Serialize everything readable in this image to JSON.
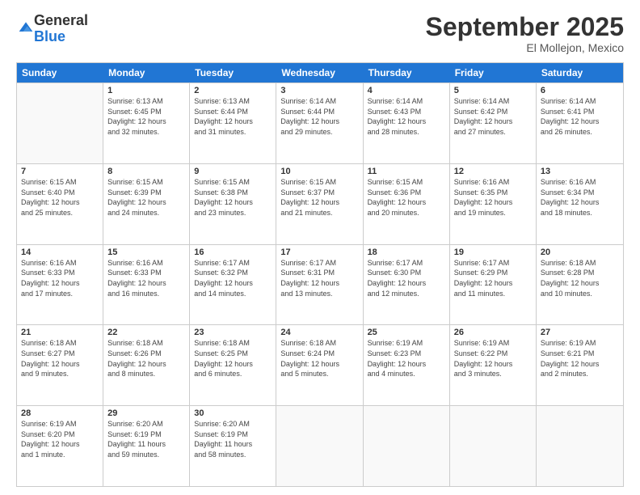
{
  "logo": {
    "general": "General",
    "blue": "Blue"
  },
  "title": "September 2025",
  "location": "El Mollejon, Mexico",
  "days_header": [
    "Sunday",
    "Monday",
    "Tuesday",
    "Wednesday",
    "Thursday",
    "Friday",
    "Saturday"
  ],
  "weeks": [
    [
      {
        "day": "",
        "info": ""
      },
      {
        "day": "1",
        "info": "Sunrise: 6:13 AM\nSunset: 6:45 PM\nDaylight: 12 hours\nand 32 minutes."
      },
      {
        "day": "2",
        "info": "Sunrise: 6:13 AM\nSunset: 6:44 PM\nDaylight: 12 hours\nand 31 minutes."
      },
      {
        "day": "3",
        "info": "Sunrise: 6:14 AM\nSunset: 6:44 PM\nDaylight: 12 hours\nand 29 minutes."
      },
      {
        "day": "4",
        "info": "Sunrise: 6:14 AM\nSunset: 6:43 PM\nDaylight: 12 hours\nand 28 minutes."
      },
      {
        "day": "5",
        "info": "Sunrise: 6:14 AM\nSunset: 6:42 PM\nDaylight: 12 hours\nand 27 minutes."
      },
      {
        "day": "6",
        "info": "Sunrise: 6:14 AM\nSunset: 6:41 PM\nDaylight: 12 hours\nand 26 minutes."
      }
    ],
    [
      {
        "day": "7",
        "info": "Sunrise: 6:15 AM\nSunset: 6:40 PM\nDaylight: 12 hours\nand 25 minutes."
      },
      {
        "day": "8",
        "info": "Sunrise: 6:15 AM\nSunset: 6:39 PM\nDaylight: 12 hours\nand 24 minutes."
      },
      {
        "day": "9",
        "info": "Sunrise: 6:15 AM\nSunset: 6:38 PM\nDaylight: 12 hours\nand 23 minutes."
      },
      {
        "day": "10",
        "info": "Sunrise: 6:15 AM\nSunset: 6:37 PM\nDaylight: 12 hours\nand 21 minutes."
      },
      {
        "day": "11",
        "info": "Sunrise: 6:15 AM\nSunset: 6:36 PM\nDaylight: 12 hours\nand 20 minutes."
      },
      {
        "day": "12",
        "info": "Sunrise: 6:16 AM\nSunset: 6:35 PM\nDaylight: 12 hours\nand 19 minutes."
      },
      {
        "day": "13",
        "info": "Sunrise: 6:16 AM\nSunset: 6:34 PM\nDaylight: 12 hours\nand 18 minutes."
      }
    ],
    [
      {
        "day": "14",
        "info": "Sunrise: 6:16 AM\nSunset: 6:33 PM\nDaylight: 12 hours\nand 17 minutes."
      },
      {
        "day": "15",
        "info": "Sunrise: 6:16 AM\nSunset: 6:33 PM\nDaylight: 12 hours\nand 16 minutes."
      },
      {
        "day": "16",
        "info": "Sunrise: 6:17 AM\nSunset: 6:32 PM\nDaylight: 12 hours\nand 14 minutes."
      },
      {
        "day": "17",
        "info": "Sunrise: 6:17 AM\nSunset: 6:31 PM\nDaylight: 12 hours\nand 13 minutes."
      },
      {
        "day": "18",
        "info": "Sunrise: 6:17 AM\nSunset: 6:30 PM\nDaylight: 12 hours\nand 12 minutes."
      },
      {
        "day": "19",
        "info": "Sunrise: 6:17 AM\nSunset: 6:29 PM\nDaylight: 12 hours\nand 11 minutes."
      },
      {
        "day": "20",
        "info": "Sunrise: 6:18 AM\nSunset: 6:28 PM\nDaylight: 12 hours\nand 10 minutes."
      }
    ],
    [
      {
        "day": "21",
        "info": "Sunrise: 6:18 AM\nSunset: 6:27 PM\nDaylight: 12 hours\nand 9 minutes."
      },
      {
        "day": "22",
        "info": "Sunrise: 6:18 AM\nSunset: 6:26 PM\nDaylight: 12 hours\nand 8 minutes."
      },
      {
        "day": "23",
        "info": "Sunrise: 6:18 AM\nSunset: 6:25 PM\nDaylight: 12 hours\nand 6 minutes."
      },
      {
        "day": "24",
        "info": "Sunrise: 6:18 AM\nSunset: 6:24 PM\nDaylight: 12 hours\nand 5 minutes."
      },
      {
        "day": "25",
        "info": "Sunrise: 6:19 AM\nSunset: 6:23 PM\nDaylight: 12 hours\nand 4 minutes."
      },
      {
        "day": "26",
        "info": "Sunrise: 6:19 AM\nSunset: 6:22 PM\nDaylight: 12 hours\nand 3 minutes."
      },
      {
        "day": "27",
        "info": "Sunrise: 6:19 AM\nSunset: 6:21 PM\nDaylight: 12 hours\nand 2 minutes."
      }
    ],
    [
      {
        "day": "28",
        "info": "Sunrise: 6:19 AM\nSunset: 6:20 PM\nDaylight: 12 hours\nand 1 minute."
      },
      {
        "day": "29",
        "info": "Sunrise: 6:20 AM\nSunset: 6:19 PM\nDaylight: 11 hours\nand 59 minutes."
      },
      {
        "day": "30",
        "info": "Sunrise: 6:20 AM\nSunset: 6:19 PM\nDaylight: 11 hours\nand 58 minutes."
      },
      {
        "day": "",
        "info": ""
      },
      {
        "day": "",
        "info": ""
      },
      {
        "day": "",
        "info": ""
      },
      {
        "day": "",
        "info": ""
      }
    ]
  ]
}
